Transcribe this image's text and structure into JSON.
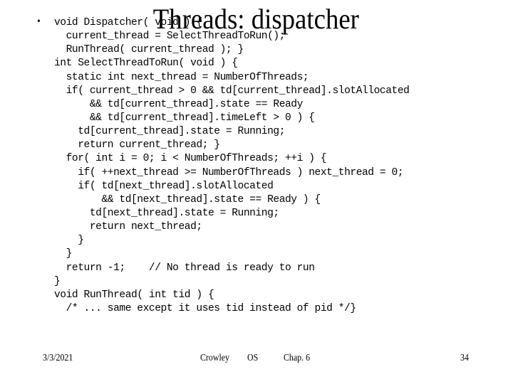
{
  "slide": {
    "title": "Threads: dispatcher",
    "bullet_glyph": "•",
    "code_lines": [
      "void Dispatcher( void ) {",
      "  current_thread = SelectThreadToRun();",
      "  RunThread( current_thread ); }",
      "int SelectThreadToRun( void ) {",
      "  static int next_thread = NumberOfThreads;",
      "  if( current_thread > 0 && td[current_thread].slotAllocated",
      "      && td[current_thread].state == Ready",
      "      && td[current_thread].timeLeft > 0 ) {",
      "    td[current_thread].state = Running;",
      "    return current_thread; }",
      "  for( int i = 0; i < NumberOfThreads; ++i ) {",
      "    if( ++next_thread >= NumberOfThreads ) next_thread = 0;",
      "    if( td[next_thread].slotAllocated",
      "        && td[next_thread].state == Ready ) {",
      "      td[next_thread].state = Running;",
      "      return next_thread;",
      "    }",
      "  }",
      "  return -1;    // No thread is ready to run",
      "}",
      "void RunThread( int tid ) {",
      "  /* ... same except it uses tid instead of pid */}"
    ]
  },
  "footer": {
    "date": "3/3/2021",
    "author": "Crowley",
    "course": "OS",
    "chapter": "Chap. 6",
    "page_number": "34"
  }
}
